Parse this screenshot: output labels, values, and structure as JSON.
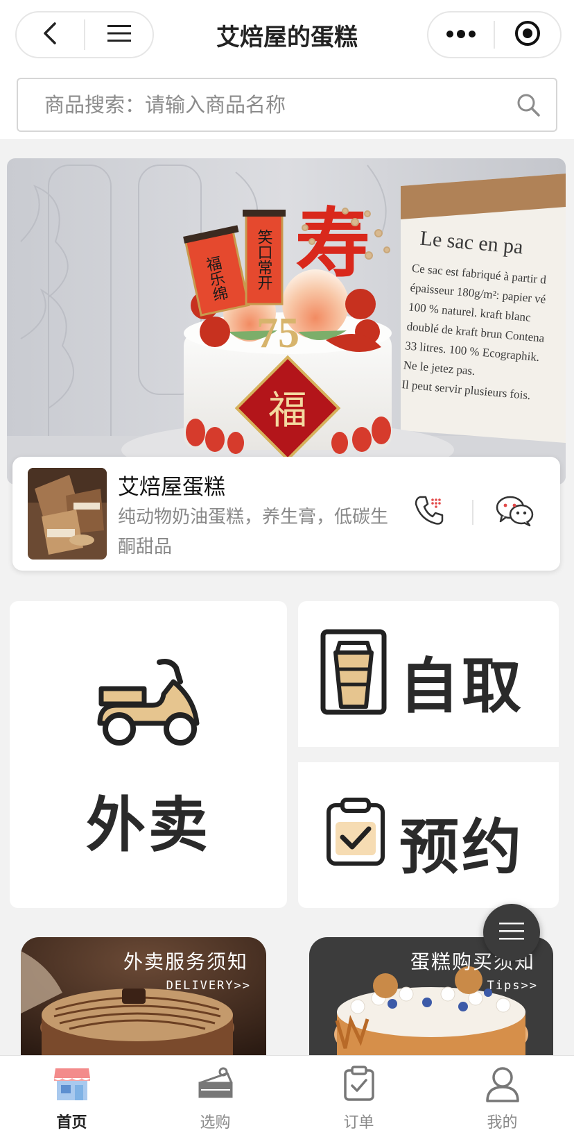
{
  "header": {
    "title": "艾焙屋的蛋糕",
    "back_icon": "chevron-left-icon",
    "menu_icon": "hamburger-icon",
    "more_icon": "more-dots-icon",
    "close_icon": "target-icon"
  },
  "search": {
    "placeholder": "商品搜索：请输入商品名称",
    "value": ""
  },
  "banner": {
    "bag_text": [
      "Le sac en pa",
      "Ce sac est fabriqué à partir d",
      "épaisseur 180g/m²: papier vé",
      "100 % naturel. kraft blanc",
      "doublé de kraft brun Contena",
      "33 litres. 100 % Ecographik.",
      "Ne le jetez pas.",
      "Il peut servir plusieurs fois."
    ],
    "scroll_left": "福乐绵",
    "scroll_right": "笑口常开",
    "cake_number": "75",
    "fu_char": "福",
    "shou_char": "寿"
  },
  "shop": {
    "name": "艾焙屋蛋糕",
    "description": "纯动物奶油蛋糕，养生膏，低碳生酮甜品"
  },
  "services": {
    "delivery": "外卖",
    "pickup": "自取",
    "reserve": "预约"
  },
  "notices": [
    {
      "title": "外卖服务须知",
      "sub": "DELIVERY>>"
    },
    {
      "title": "蛋糕购买须知",
      "sub": "Tips>>"
    }
  ],
  "tabs": [
    {
      "label": "首页",
      "icon": "store-icon",
      "active": true
    },
    {
      "label": "选购",
      "icon": "cake-slice-icon",
      "active": false
    },
    {
      "label": "订单",
      "icon": "order-clipboard-icon",
      "active": false
    },
    {
      "label": "我的",
      "icon": "user-icon",
      "active": false
    }
  ],
  "colors": {
    "accent_beige": "#e6c58f",
    "banner_red": "#d9281c",
    "tab_active_pink": "#f38b8b",
    "tab_active_blue": "#7fb2e5"
  }
}
